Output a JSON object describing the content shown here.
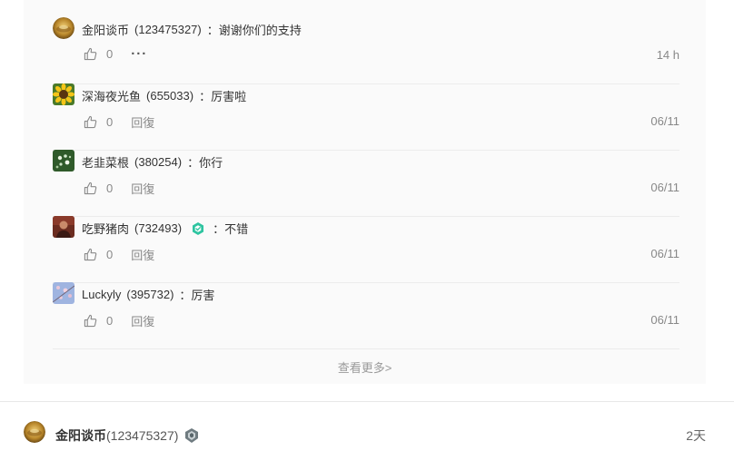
{
  "comments": [
    {
      "name": "金阳谈币",
      "uid": "(123475327)",
      "text": "：谢谢你们的支持",
      "likes": "0",
      "action": "···",
      "time": "14 h",
      "avatar": "gold-ingot"
    },
    {
      "name": "深海夜光鱼",
      "uid": "(655033)",
      "text": "：厉害啦",
      "likes": "0",
      "action": "回復",
      "time": "06/11",
      "avatar": "sunflower"
    },
    {
      "name": "老韭菜根",
      "uid": "(380254)",
      "text": "：你行",
      "likes": "0",
      "action": "回復",
      "time": "06/11",
      "avatar": "green-plant"
    },
    {
      "name": "吃野猪肉",
      "uid": "(732493)",
      "text": "：不错",
      "likes": "0",
      "action": "回復",
      "time": "06/11",
      "avatar": "portrait",
      "badge": "verified-badge"
    },
    {
      "name": "Luckyly",
      "uid": "(395732)",
      "text": "：厉害",
      "likes": "0",
      "action": "回復",
      "time": "06/11",
      "avatar": "blossom"
    }
  ],
  "more_link": "查看更多>",
  "post": {
    "author": "金阳谈币",
    "uid": "(123475327)",
    "time": "2天",
    "level_icon": "level-badge"
  },
  "colors": {
    "accent": "#12b7d4",
    "panel_bg": "#fafafa",
    "verified": "#2ec4a0"
  }
}
